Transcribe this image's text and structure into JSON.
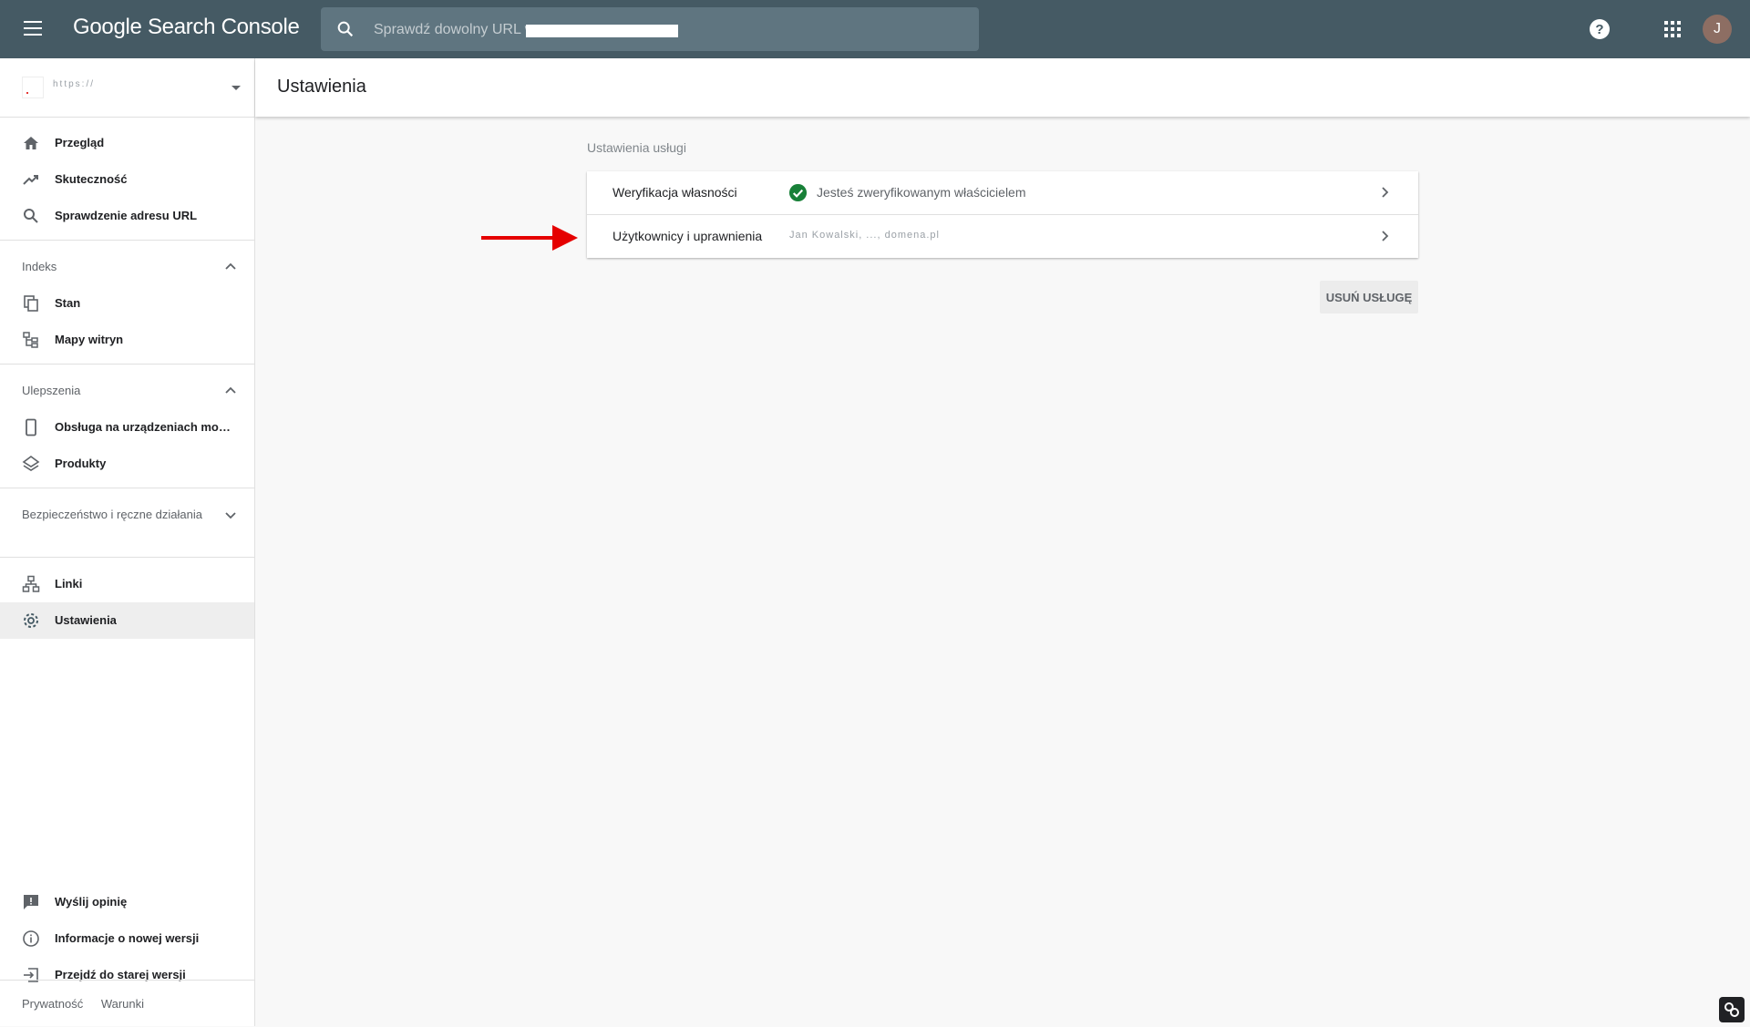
{
  "header": {
    "app_title": "Google Search Console",
    "search_placeholder": "Sprawdź dowolny URL w",
    "avatar_initial": "J"
  },
  "sidebar": {
    "property_label": "https://",
    "items": [
      {
        "label": "Przegląd",
        "icon": "home-icon"
      },
      {
        "label": "Skuteczność",
        "icon": "trending-up-icon"
      },
      {
        "label": "Sprawdzenie adresu URL",
        "icon": "search-icon"
      }
    ],
    "sections": [
      {
        "title": "Indeks",
        "expanded": true,
        "items": [
          {
            "label": "Stan",
            "icon": "copy-pages-icon"
          },
          {
            "label": "Mapy witryn",
            "icon": "sitemap-icon"
          }
        ]
      },
      {
        "title": "Ulepszenia",
        "expanded": true,
        "items": [
          {
            "label": "Obsługa na urządzeniach mobilnych",
            "icon": "smartphone-icon"
          },
          {
            "label": "Produkty",
            "icon": "layers-icon"
          }
        ]
      },
      {
        "title": "Bezpieczeństwo i ręczne działania",
        "expanded": false,
        "items": []
      }
    ],
    "bottom_items": [
      {
        "label": "Linki",
        "icon": "links-icon"
      },
      {
        "label": "Ustawienia",
        "icon": "gear-icon",
        "active": true
      }
    ],
    "feedback_items": [
      {
        "label": "Wyślij opinię",
        "icon": "feedback-icon"
      },
      {
        "label": "Informacje o nowej wersji",
        "icon": "info-icon"
      },
      {
        "label": "Przejdź do starej wersji",
        "icon": "exit-icon"
      }
    ],
    "footer": {
      "privacy": "Prywatność",
      "terms": "Warunki"
    }
  },
  "main": {
    "page_title": "Ustawienia",
    "section_title": "Ustawienia usługi",
    "rows": [
      {
        "label": "Weryfikacja własności",
        "value": "Jesteś zweryfikowanym właścicielem"
      },
      {
        "label": "Użytkownicy i uprawnienia",
        "value": "Jan Kowalski, ..., domena.pl"
      }
    ],
    "delete_button": "USUŃ USŁUGĘ"
  },
  "colors": {
    "topbar": "#455a64",
    "check": "#188038",
    "annotation_arrow": "#e50000"
  }
}
